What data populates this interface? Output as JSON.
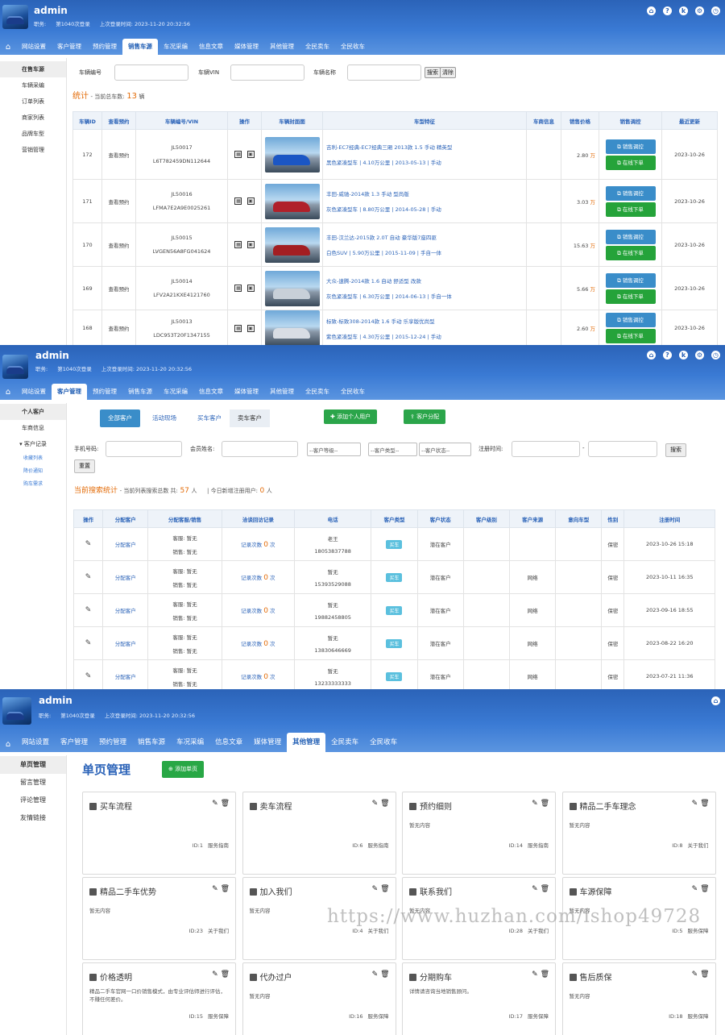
{
  "user": {
    "name": "admin",
    "role_prefix": "职务:",
    "logins": "第1040次登录",
    "last_login": "上次登录时间: 2023-11-20 20:32:56"
  },
  "nav": [
    "网站设置",
    "客户管理",
    "预约管理",
    "销售车源",
    "车况采编",
    "信息文章",
    "媒体管理",
    "其他管理",
    "全民卖车",
    "全民收车"
  ],
  "panel1": {
    "active_tab": "销售车源",
    "side": [
      "在售车源",
      "车辆采编",
      "订单列表",
      "商家列表",
      "品牌车型",
      "营销管理"
    ],
    "search": {
      "car_no_label": "车辆编号",
      "vin_label": "车辆VIN",
      "name_label": "车辆名称",
      "search_btn": "搜索",
      "reset_btn": "清除"
    },
    "stats": {
      "title": "统计",
      "text": "- 当前总车数:",
      "count": "13",
      "unit": "辆"
    },
    "columns": [
      "车辆ID",
      "查看预约",
      "车辆编号/VIN",
      "操作",
      "车辆封面图",
      "车型特征",
      "车商信息",
      "销售价格",
      "销售调控",
      "最近更新"
    ],
    "btn_control": "销售调控",
    "btn_order": "在线下单",
    "view": "查看预约",
    "price_unit": "万",
    "rows": [
      {
        "id": "172",
        "code": "JL50017",
        "vin": "L6T782459DN112644",
        "title": "吉利-EC7经典-EC7经典三厢 2013款 1.5 手动 精英型",
        "spec": "黑色紧凑型车 | 4.10万公里 | 2013-05-13 | 手动",
        "price": "2.80",
        "date": "2023-10-26",
        "color": "#1b56c4"
      },
      {
        "id": "171",
        "code": "JL50016",
        "vin": "LFMA7E2A9E0025261",
        "title": "丰田-威驰-2014款 1.3 手动 型尚版",
        "spec": "灰色紧凑型车 | 8.80万公里 | 2014-05-28 | 手动",
        "price": "3.03",
        "date": "2023-10-26",
        "color": "#b0202a"
      },
      {
        "id": "170",
        "code": "JL50015",
        "vin": "LVGEN56A8FG041624",
        "title": "丰田-汉兰达-2015款 2.0T 自动 豪华版7座四驱",
        "spec": "白色SUV | 5.90万公里 | 2015-11-09 | 手自一体",
        "price": "15.63",
        "date": "2023-10-26",
        "color": "#a31e22"
      },
      {
        "id": "169",
        "code": "JL50014",
        "vin": "LFV2A21KXE4121760",
        "title": "大众-速腾-2014款 1.6 自动 舒适型 改款",
        "spec": "灰色紧凑型车 | 6.30万公里 | 2014-06-13 | 手自一体",
        "price": "5.66",
        "date": "2023-10-26",
        "color": "#c8d0d8"
      },
      {
        "id": "168",
        "code": "JL50013",
        "vin": "LDC953T20F1347155",
        "title": "标致-标致308-2014款 1.6 手动 乐享版优尚型",
        "spec": "紫色紧凑型车 | 4.30万公里 | 2015-12-24 | 手动",
        "price": "2.60",
        "date": "2023-10-26",
        "color": "#d8dde4"
      }
    ]
  },
  "panel2": {
    "active_tab": "客户管理",
    "side": [
      "个人客户",
      "车商信息",
      "客户记录"
    ],
    "side_sub": [
      "收藏列表",
      "降价通知",
      "购车需求"
    ],
    "tabs": [
      "全部客户",
      "活动现场",
      "买车客户",
      "卖车客户"
    ],
    "add_btn": "添加个人用户",
    "assign_btn": "客户分配",
    "filters": {
      "phone": "手机号码:",
      "member": "会员姓名:",
      "level": "--客户等级--",
      "type": "--客户类型--",
      "status": "--客户状态--",
      "regtime": "注册时间:",
      "dash": "-",
      "search": "搜索",
      "reset": "重置"
    },
    "stats": {
      "title": "当前搜索统计",
      "text": "- 当前列表搜索总数 共:",
      "count": "57",
      "unit": "人",
      "today": "| 今日新增注册用户:",
      "today_count": "0",
      "today_unit": "人"
    },
    "columns": [
      "操作",
      "分配客户",
      "分配客服/销售",
      "洽谈回访记录",
      "电话",
      "客户类型",
      "客户状态",
      "客户级别",
      "客户来源",
      "意向车型",
      "性别",
      "注册时间"
    ],
    "assign": "分配客户",
    "svc": "客服: 暂无",
    "sales": "销售: 暂无",
    "rec_pre": "记录次数",
    "rec_num": "0",
    "rec_unit": "次",
    "type": "买车",
    "status": "潜在客户",
    "gender": "保密",
    "rows": [
      {
        "name": "老王",
        "phone": "18053837788",
        "source": "",
        "time": "2023-10-26 15:18"
      },
      {
        "name": "暂无",
        "phone": "15393529088",
        "source": "网络",
        "time": "2023-10-11 16:35"
      },
      {
        "name": "暂无",
        "phone": "19882458805",
        "source": "网络",
        "time": "2023-09-16 18:55"
      },
      {
        "name": "暂无",
        "phone": "13830646669",
        "source": "网络",
        "time": "2023-08-22 16:20"
      },
      {
        "name": "暂无",
        "phone": "13233333333",
        "source": "网络",
        "time": "2023-07-21 11:36"
      }
    ]
  },
  "panel3": {
    "active_tab": "其他管理",
    "side": [
      "单页管理",
      "留言管理",
      "评论管理",
      "友情链接"
    ],
    "title": "单页管理",
    "add_btn": "添加单页",
    "cards": [
      {
        "title": "买车流程",
        "body": "",
        "id": "ID:1",
        "cat": "服务指南"
      },
      {
        "title": "卖车流程",
        "body": "",
        "id": "ID:6",
        "cat": "服务指南"
      },
      {
        "title": "预约细则",
        "body": "暂无内容",
        "id": "ID:14",
        "cat": "服务指南"
      },
      {
        "title": "精品二手车理念",
        "body": "暂无内容",
        "id": "ID:8",
        "cat": "关于我们"
      },
      {
        "title": "精品二手车优势",
        "body": "暂无内容",
        "id": "ID:23",
        "cat": "关于我们"
      },
      {
        "title": "加入我们",
        "body": "暂无内容",
        "id": "ID:4",
        "cat": "关于我们"
      },
      {
        "title": "联系我们",
        "body": "暂无内容",
        "id": "ID:28",
        "cat": "关于我们"
      },
      {
        "title": "车源保障",
        "body": "暂无内容",
        "id": "ID:5",
        "cat": "服务保障"
      },
      {
        "title": "价格透明",
        "body": "精品二手车官网一口价销售模式，由专业评估师进行评估，不赚任何差价。",
        "id": "ID:15",
        "cat": "服务保障"
      },
      {
        "title": "代办过户",
        "body": "暂无内容",
        "id": "ID:16",
        "cat": "服务保障"
      },
      {
        "title": "分期购车",
        "body": "详情请咨询当地销售顾问。",
        "id": "ID:17",
        "cat": "服务保障"
      },
      {
        "title": "售后质保",
        "body": "暂无内容",
        "id": "ID:18",
        "cat": "服务保障"
      }
    ]
  },
  "watermark": "https://www.huzhan.com/ishop49728",
  "colors": {
    "header": "#3a7ad4",
    "accent": "#2b63b8",
    "green": "#25a33a",
    "price": "#e36c09"
  }
}
